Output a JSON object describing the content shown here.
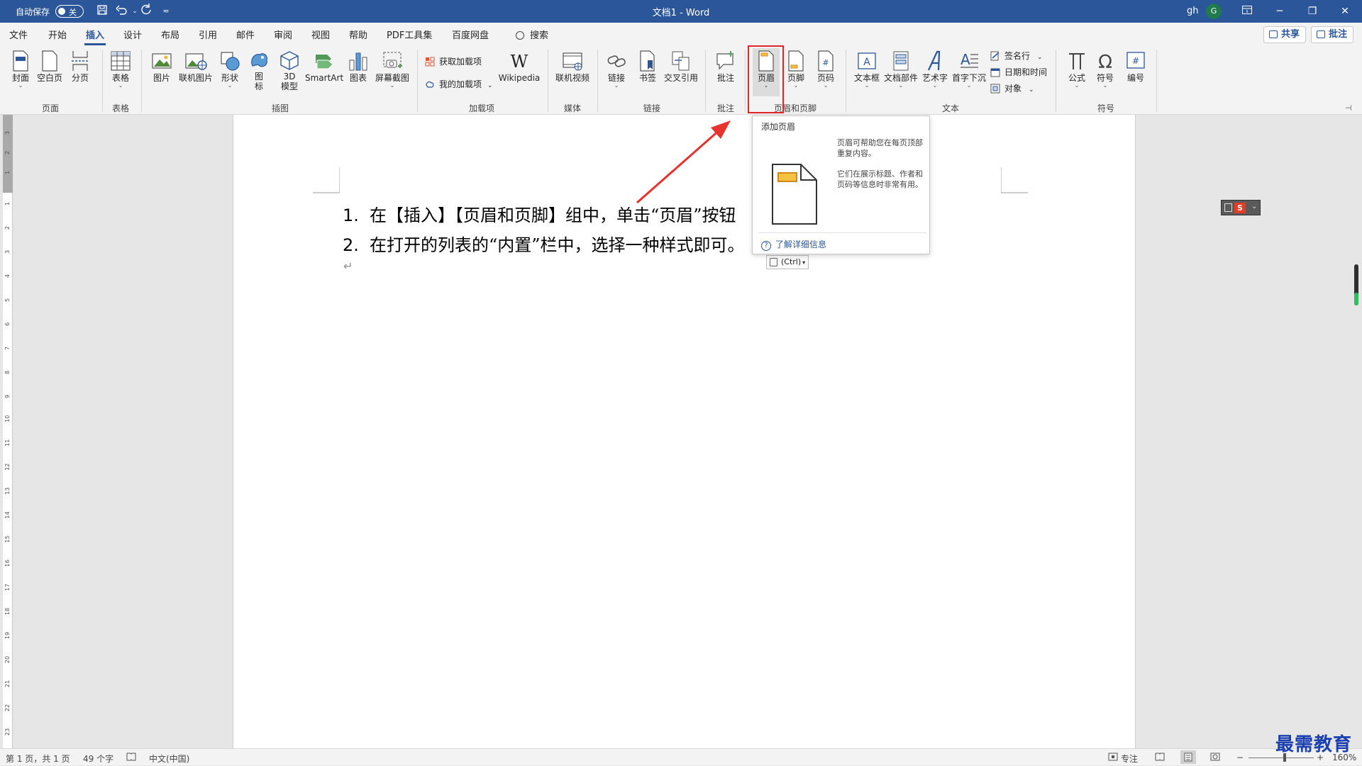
{
  "titlebar": {
    "autosave_label": "自动保存",
    "autosave_state": "关",
    "doc_title": "文档1 - Word",
    "user": "gh",
    "avatar_initial": "G"
  },
  "tabs": [
    "文件",
    "开始",
    "插入",
    "设计",
    "布局",
    "引用",
    "邮件",
    "审阅",
    "视图",
    "帮助",
    "PDF工具集",
    "百度网盘"
  ],
  "active_tab": "插入",
  "search_label": "搜索",
  "share_label": "共享",
  "comment_label": "批注",
  "ribbon": {
    "buttons": {
      "cover": "封面",
      "blank_page": "空白页",
      "page_break": "分页",
      "table": "表格",
      "picture": "图片",
      "online_picture": "联机图片",
      "shapes": "形状",
      "icons_l1": "图",
      "icons_l2": "标",
      "model3d_l1": "3D",
      "model3d_l2": "模型",
      "smartart": "SmartArt",
      "chart": "图表",
      "screenshot": "屏幕截图",
      "get_addins": "获取加载项",
      "my_addins": "我的加载项",
      "wikipedia": "Wikipedia",
      "online_video": "联机视频",
      "link": "链接",
      "bookmark": "书签",
      "cross_ref": "交叉引用",
      "comment": "批注",
      "header": "页眉",
      "footer": "页脚",
      "page_number": "页码",
      "textbox": "文本框",
      "quick_parts": "文档部件",
      "wordart": "艺术字",
      "dropcap": "首字下沉",
      "signature": "签名行",
      "datetime": "日期和时间",
      "object": "对象",
      "equation": "公式",
      "symbol": "符号",
      "numbering": "编号"
    },
    "groups": {
      "pages": "页面",
      "tables": "表格",
      "illustrations": "插图",
      "addins": "加载项",
      "media": "媒体",
      "links": "链接",
      "comments": "批注",
      "header_footer": "页眉和页脚",
      "text": "文本",
      "symbols": "符号"
    }
  },
  "document": {
    "items": [
      {
        "num": "1.",
        "text": "在【插入】【页眉和页脚】组中，单击“页眉”按钮"
      },
      {
        "num": "2.",
        "text": "在打开的列表的“内置”栏中，选择一种样式即可。"
      }
    ],
    "paragraph_mark": "↵",
    "paste_label": "(Ctrl)",
    "sogou_label": "S"
  },
  "ruler_numbers": [
    "3",
    "2",
    "1",
    "1",
    "2",
    "3",
    "4",
    "5",
    "6",
    "7",
    "8",
    "9",
    "10",
    "11",
    "12",
    "13",
    "14",
    "15",
    "16",
    "17",
    "18",
    "19",
    "20",
    "21",
    "22",
    "23"
  ],
  "popup": {
    "title": "添加页眉",
    "desc1": "页眉可帮助您在每页顶部重复内容。",
    "desc2": "它们在展示标题、作者和页码等信息时非常有用。",
    "link": "了解详细信息"
  },
  "statusbar": {
    "page": "第 1 页，共 1 页",
    "words": "49 个字",
    "language": "中文(中国)",
    "focus": "专注",
    "zoom_minus": "−",
    "zoom_plus": "+",
    "zoom": "160%"
  },
  "watermark": "最需教育",
  "colors": {
    "accent": "#2b579a",
    "highlight": "#e0262a",
    "arrow": "#e8322e"
  }
}
